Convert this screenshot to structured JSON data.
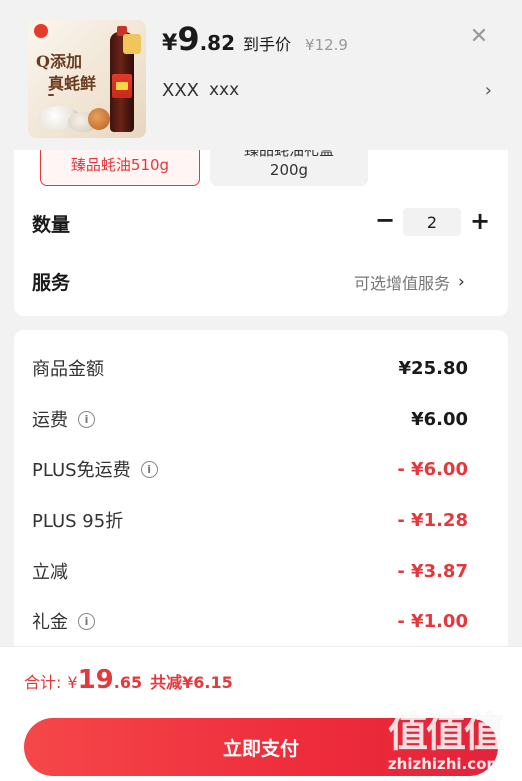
{
  "header": {
    "price_symbol": "¥",
    "price_integer": "9",
    "price_decimal": ".82",
    "price_label": "到手价",
    "original_price": "¥12.9",
    "close_icon": "close-icon",
    "variant_primary": "XXX",
    "variant_secondary": "xxx",
    "variant_chevron": "›",
    "product_image": {
      "slogan_line1": "Q添加",
      "slogan_line2": "真蚝鲜"
    }
  },
  "specs": {
    "selected": "臻品蚝油510g",
    "other_line1": "臻品蚝油礼盒",
    "other_line2": "200g"
  },
  "quantity": {
    "label": "数量",
    "minus": "−",
    "value": "2",
    "plus": "+"
  },
  "service": {
    "label": "服务",
    "value": "可选增值服务",
    "chevron": "›"
  },
  "fees": [
    {
      "label": "商品金额",
      "value": "¥25.80",
      "info": false,
      "red": false
    },
    {
      "label": "运费",
      "value": "¥6.00",
      "info": true,
      "red": false
    },
    {
      "label": "PLUS免运费",
      "value": "- ¥6.00",
      "info": true,
      "red": true
    },
    {
      "label": "PLUS 95折",
      "value": "- ¥1.28",
      "info": false,
      "red": true
    },
    {
      "label": "立减",
      "value": "- ¥3.87",
      "info": false,
      "red": true
    },
    {
      "label": "礼金",
      "value": "- ¥1.00",
      "info": true,
      "red": true
    }
  ],
  "info_icon_glyph": "i",
  "footer": {
    "total_label": "合计:",
    "total_symbol": "¥",
    "total_integer": "19",
    "total_decimal": ".65",
    "total_savings": "共减¥6.15",
    "pay_button": "立即支付"
  },
  "watermark": {
    "logo": "值值值",
    "url": "zhizhizhi.com"
  },
  "colors": {
    "accent_red": "#e4393c",
    "button_gradient_start": "#f5474a",
    "button_gradient_end": "#e2233a"
  }
}
